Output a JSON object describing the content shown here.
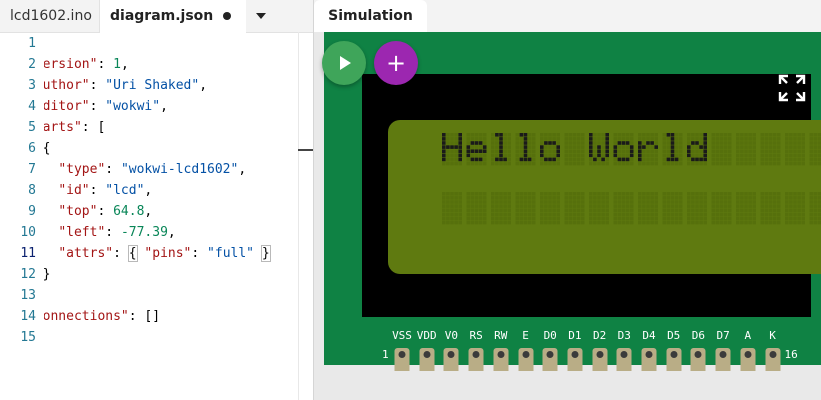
{
  "editor": {
    "tabs": [
      {
        "label": "lcd1602.ino"
      },
      {
        "label": "diagram.json",
        "modified": true
      }
    ],
    "active_line": 11,
    "lines": [
      {
        "n": "1"
      },
      {
        "n": "2",
        "key": "\"version\"",
        "after": ": ",
        "value": "1",
        "vtype": "number",
        "tail": ","
      },
      {
        "n": "3",
        "key": "\"author\"",
        "after": ": ",
        "value": "\"Uri Shaked\"",
        "vtype": "string",
        "tail": ","
      },
      {
        "n": "4",
        "key": "\"editor\"",
        "after": ": ",
        "value": "\"wokwi\"",
        "vtype": "string",
        "tail": ","
      },
      {
        "n": "5",
        "key": "\"parts\"",
        "after": ": [",
        "value": "",
        "vtype": "",
        "tail": ""
      },
      {
        "n": "6",
        "pre": "{"
      },
      {
        "n": "7",
        "key": "\"type\"",
        "after": ": ",
        "value": "\"wokwi-lcd1602\"",
        "vtype": "string",
        "tail": ","
      },
      {
        "n": "8",
        "key": "\"id\"",
        "after": ": ",
        "value": "\"lcd\"",
        "vtype": "string",
        "tail": ","
      },
      {
        "n": "9",
        "key": "\"top\"",
        "after": ": ",
        "value": "64.8",
        "vtype": "number",
        "tail": ","
      },
      {
        "n": "10",
        "key": "\"left\"",
        "after": ": ",
        "value": "-77.39",
        "vtype": "number",
        "tail": ","
      },
      {
        "n": "11",
        "key": "\"attrs\"",
        "after": ": ",
        "brace_open": "{",
        "inner_key": "\"pins\"",
        "inner_after": ": ",
        "value": "\"full\"",
        "vtype": "string",
        "brace_close": "}"
      },
      {
        "n": "12",
        "pre": "}"
      },
      {
        "n": "13"
      },
      {
        "n": "14",
        "key": "\"connections\"",
        "after": ": []",
        "value": "",
        "vtype": "",
        "tail": ""
      },
      {
        "n": "15"
      }
    ]
  },
  "simulation": {
    "tab_label": "Simulation",
    "play_icon": "play-icon",
    "add_icon": "plus-icon",
    "fullscreen_icon": "fullscreen-icon",
    "lcd_text": "Hello World",
    "pins": [
      "VSS",
      "VDD",
      "V0",
      "RS",
      "RW",
      "E",
      "D0",
      "D1",
      "D2",
      "D3",
      "D4",
      "D5",
      "D6",
      "D7",
      "A",
      "K"
    ],
    "pin_first": "1",
    "pin_last": "16",
    "colors": {
      "board": "#0f8244",
      "screen": "#5f7a10",
      "pixel_on": "#1a1a1a",
      "pixel_off": "#56700c",
      "pin_header": "#b9ad86"
    }
  }
}
